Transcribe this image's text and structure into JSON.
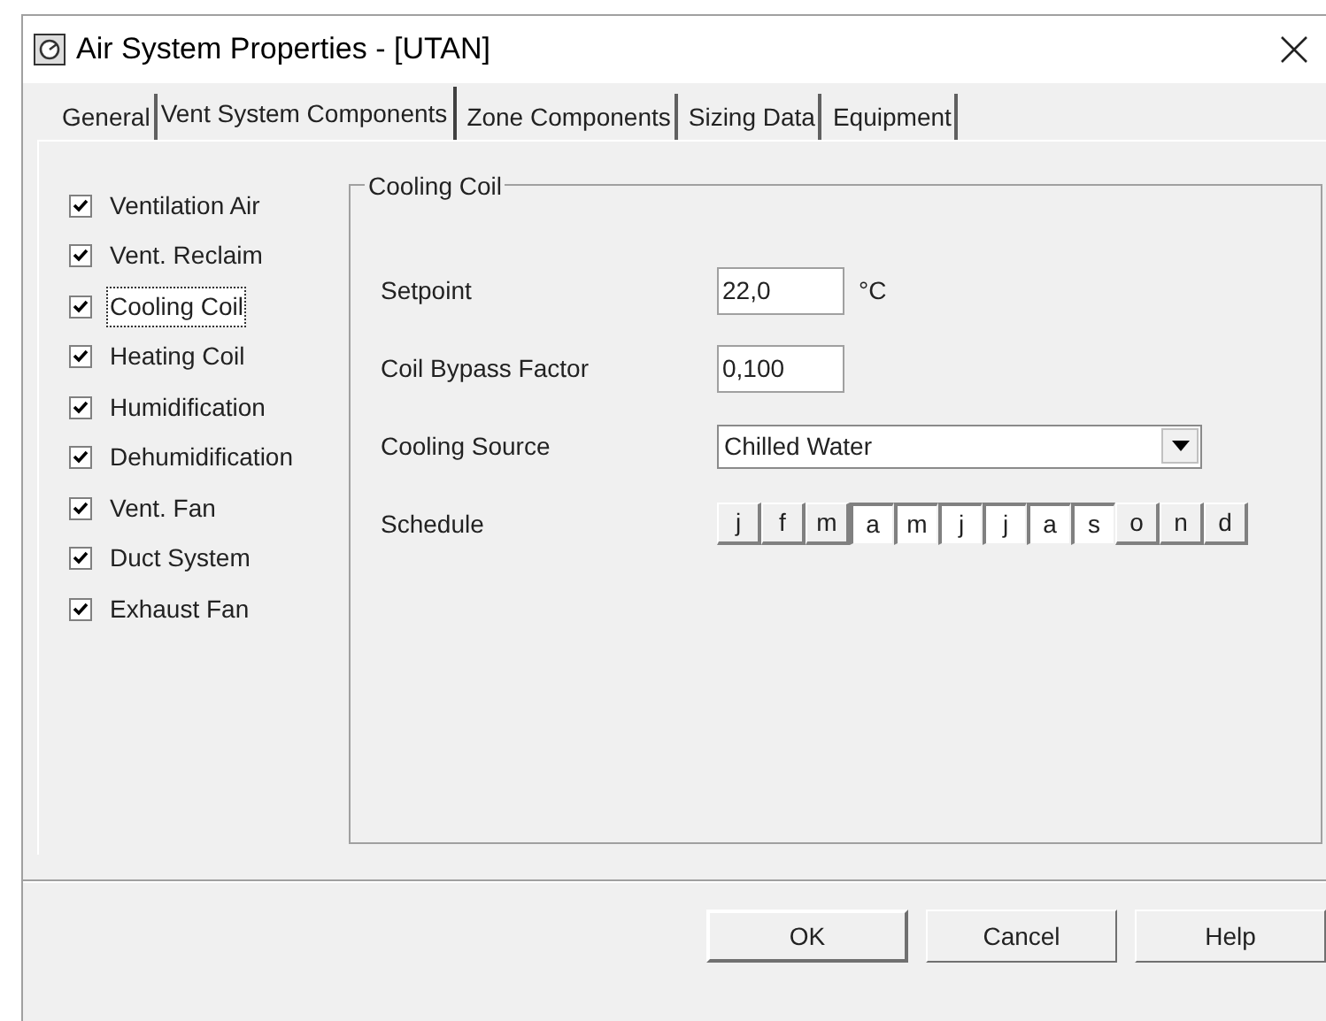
{
  "window": {
    "title": "Air System Properties - [UTAN]"
  },
  "tabs": [
    {
      "label": "General",
      "selected": false
    },
    {
      "label": "Vent System Components",
      "selected": true
    },
    {
      "label": "Zone Components",
      "selected": false
    },
    {
      "label": "Sizing Data",
      "selected": false
    },
    {
      "label": "Equipment",
      "selected": false
    }
  ],
  "components": [
    {
      "label": "Ventilation Air",
      "checked": true,
      "focused": false
    },
    {
      "label": "Vent. Reclaim",
      "checked": true,
      "focused": false
    },
    {
      "label": "Cooling Coil",
      "checked": true,
      "focused": true
    },
    {
      "label": "Heating Coil",
      "checked": true,
      "focused": false
    },
    {
      "label": "Humidification",
      "checked": true,
      "focused": false
    },
    {
      "label": "Dehumidification",
      "checked": true,
      "focused": false
    },
    {
      "label": "Vent. Fan",
      "checked": true,
      "focused": false
    },
    {
      "label": "Duct System",
      "checked": true,
      "focused": false
    },
    {
      "label": "Exhaust Fan",
      "checked": true,
      "focused": false
    }
  ],
  "group": {
    "title": "Cooling Coil",
    "fields": [
      {
        "kind": "text",
        "label": "Setpoint",
        "value": "22,0",
        "unit": "°C"
      },
      {
        "kind": "text",
        "label": "Coil Bypass Factor",
        "value": "0,100"
      },
      {
        "kind": "select",
        "label": "Cooling Source",
        "value": "Chilled Water"
      },
      {
        "kind": "months",
        "label": "Schedule",
        "months": [
          {
            "label": "j",
            "selected": false
          },
          {
            "label": "f",
            "selected": false
          },
          {
            "label": "m",
            "selected": false
          },
          {
            "label": "a",
            "selected": true
          },
          {
            "label": "m",
            "selected": true
          },
          {
            "label": "j",
            "selected": true
          },
          {
            "label": "j",
            "selected": true
          },
          {
            "label": "a",
            "selected": true
          },
          {
            "label": "s",
            "selected": true
          },
          {
            "label": "o",
            "selected": false
          },
          {
            "label": "n",
            "selected": false
          },
          {
            "label": "d",
            "selected": false
          }
        ]
      }
    ]
  },
  "buttons": [
    "OK",
    "Cancel",
    "Help"
  ]
}
